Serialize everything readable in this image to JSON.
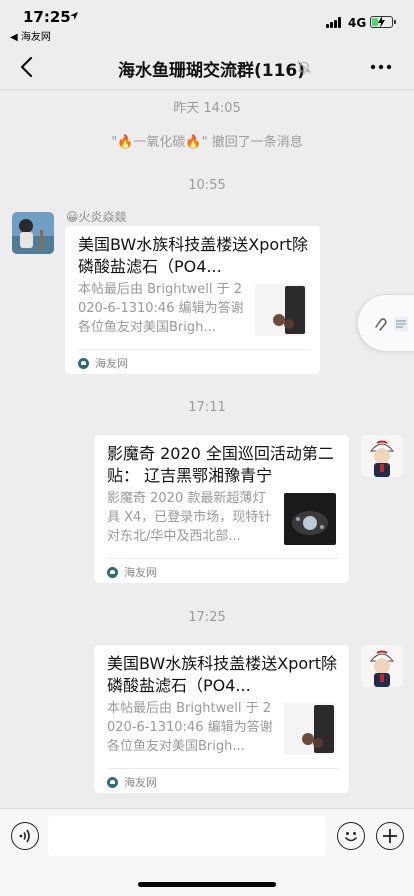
{
  "status": {
    "time": "17:25",
    "back_app": "◀ 海友网",
    "network": "4G"
  },
  "nav": {
    "title": "海水鱼珊瑚交流群(116)"
  },
  "chat": {
    "time_yesterday": "昨天 14:05",
    "recall_notice": "\"🔥一氧化碳🔥\" 撤回了一条消息",
    "time_1": "10:55",
    "time_2": "17:11",
    "time_3": "17:25",
    "messages": [
      {
        "sender": "😀火炎焱燚",
        "title": "美国BW水族科技盖楼送Xport除磷酸盐滤石（PO4...",
        "desc": "本帖最后由 Brightwell 于 2020-6-1310:46 编辑为答谢各位鱼友对美国Brigh...",
        "source": "海友网"
      },
      {
        "sender": "",
        "title": "影魔奇 2020 全国巡回活动第二贴： 辽吉黑鄂湘豫青宁",
        "desc": "影魔奇 2020 款最新超薄灯具 X4，已登录市场，现特针对东北/华中及西北部...",
        "source": "海友网"
      },
      {
        "sender": "",
        "title": "美国BW水族科技盖楼送Xport除磷酸盐滤石（PO4...",
        "desc": "本帖最后由 Brightwell 于 2020-6-1310:46 编辑为答谢各位鱼友对美国Brigh...",
        "source": "海友网"
      }
    ]
  },
  "colors": {
    "background": "#ededed",
    "card": "#ffffff",
    "battery": "#4cd964"
  }
}
